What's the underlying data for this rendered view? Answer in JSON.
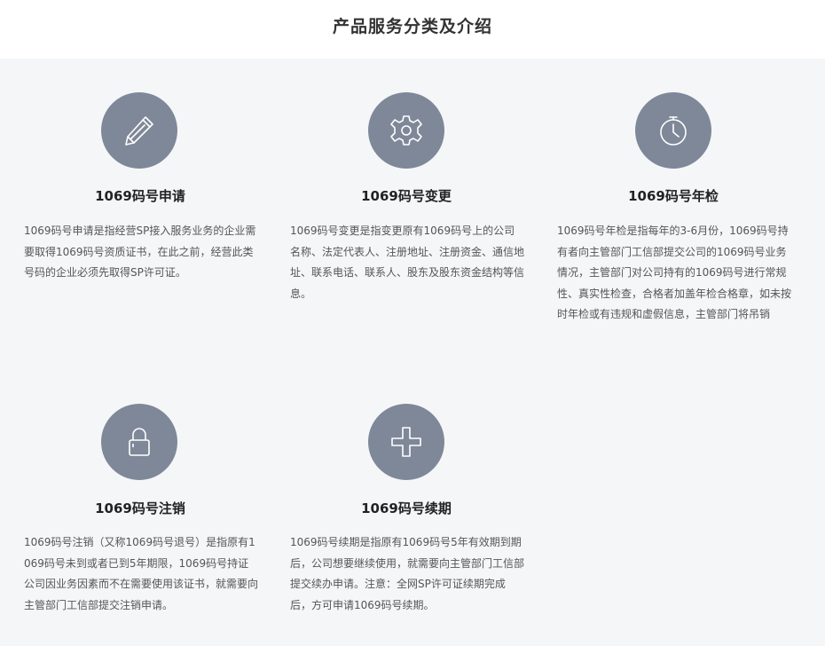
{
  "page": {
    "title": "产品服务分类及介绍"
  },
  "services": [
    {
      "icon": "pencil-icon",
      "title": "1069码号申请",
      "description": "1069码号申请是指经营SP接入服务业务的企业需要取得1069码号资质证书，在此之前，经营此类号码的企业必须先取得SP许可证。"
    },
    {
      "icon": "gear-icon",
      "title": "1069码号变更",
      "description": "1069码号变更是指变更原有1069码号上的公司名称、法定代表人、注册地址、注册资金、通信地址、联系电话、联系人、股东及股东资金结构等信息。"
    },
    {
      "icon": "stopwatch-icon",
      "title": "1069码号年检",
      "description": "1069码号年检是指每年的3-6月份，1069码号持有者向主管部门工信部提交公司的1069码号业务情况，主管部门对公司持有的1069码号进行常规性、真实性检查，合格者加盖年检合格章，如未按时年检或有违规和虚假信息，主管部门将吊销"
    },
    {
      "icon": "padlock-icon",
      "title": "1069码号注销",
      "description": "1069码号注销（又称1069码号退号）是指原有1069码号未到或者已到5年期限，1069码号持证公司因业务因素而不在需要使用该证书，就需要向主管部门工信部提交注销申请。"
    },
    {
      "icon": "plus-icon",
      "title": "1069码号续期",
      "description": "1069码号续期是指原有1069码号5年有效期到期后，公司想要继续使用，就需要向主管部门工信部提交续办申请。注意：全网SP许可证续期完成后，方可申请1069码号续期。"
    }
  ],
  "colors": {
    "icon_circle": "#7f8899",
    "background": "#f5f6f8"
  }
}
